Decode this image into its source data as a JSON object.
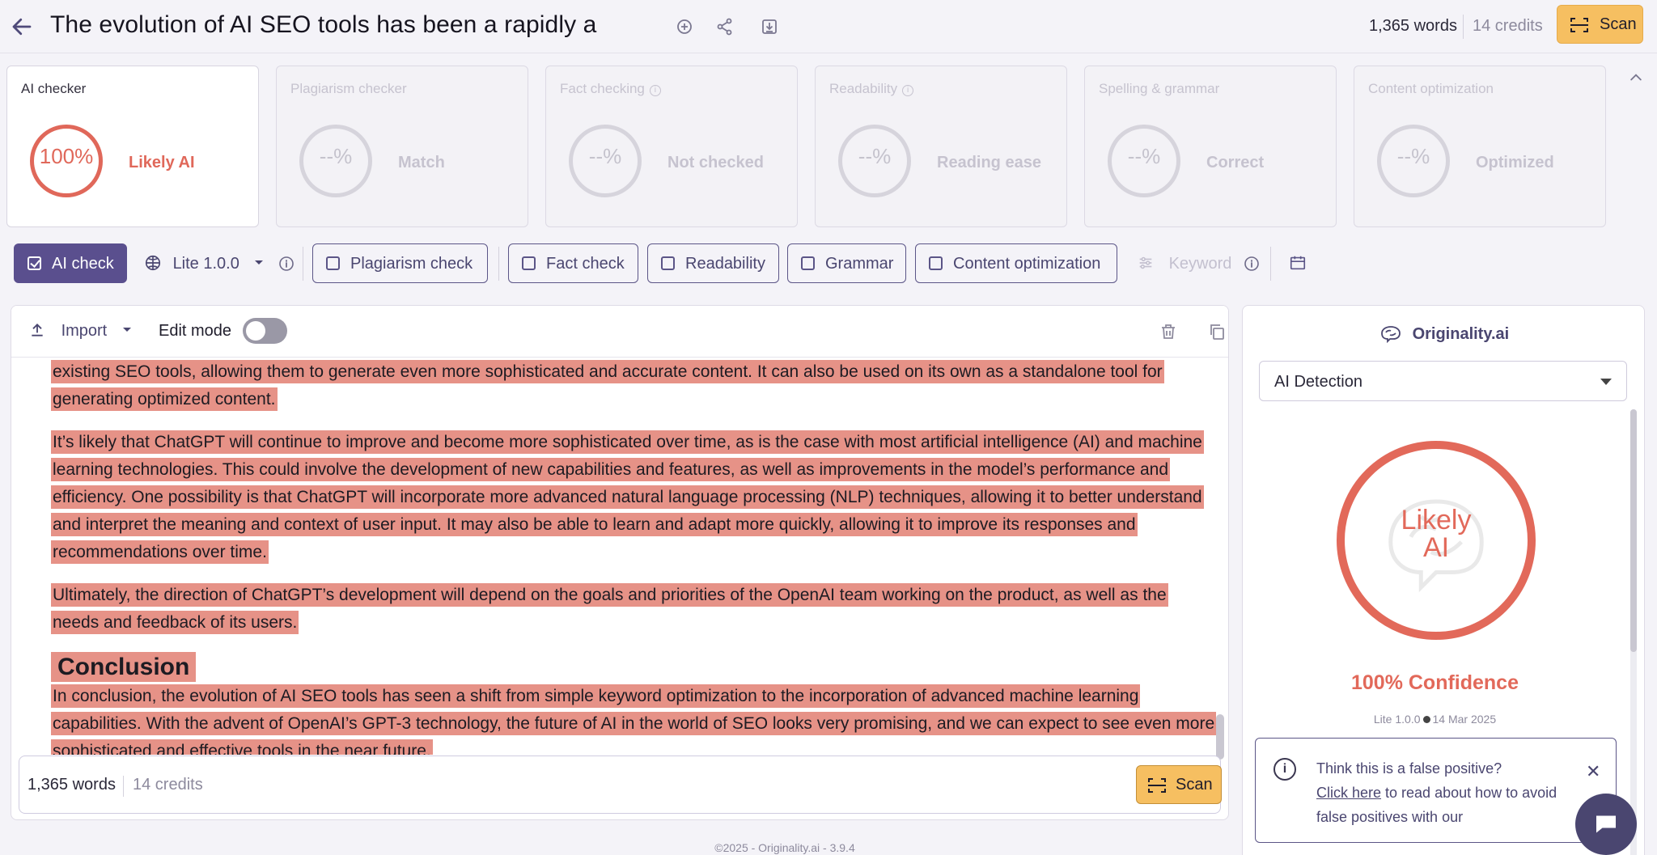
{
  "header": {
    "title": "The evolution of AI SEO tools has been a rapidly a",
    "words": "1,365 words",
    "credits": "14 credits",
    "scan_label": "Scan"
  },
  "cards": [
    {
      "title": "AI checker",
      "value": "100%",
      "status": "Likely AI",
      "active": true
    },
    {
      "title": "Plagiarism checker",
      "value": "--%",
      "status": "Match",
      "active": false
    },
    {
      "title": "Fact checking",
      "value": "--%",
      "status": "Not checked",
      "active": false
    },
    {
      "title": "Readability",
      "value": "--%",
      "status": "Reading ease",
      "active": false
    },
    {
      "title": "Spelling & grammar",
      "value": "--%",
      "status": "Correct",
      "active": false
    },
    {
      "title": "Content optimization",
      "value": "--%",
      "status": "Optimized",
      "active": false
    }
  ],
  "toolbar": {
    "ai_check": "AI check",
    "model": "Lite 1.0.0",
    "plagiarism": "Plagiarism check",
    "fact": "Fact check",
    "readability": "Readability",
    "grammar": "Grammar",
    "content_opt": "Content optimization",
    "keyword": "Keyword"
  },
  "editor": {
    "import_label": "Import",
    "edit_mode_label": "Edit mode",
    "paragraphs": [
      "existing SEO tools, allowing them to generate even more sophisticated and accurate content.   It can also be used on its own as a standalone tool for generating optimized content.",
      " It’s likely that ChatGPT will continue to improve and become more sophisticated over time, as is the case with most artificial intelligence (AI) and machine learning technologies.   This could involve the development of new capabilities and features, as well as improvements in the model’s performance and efficiency.   One possibility is that ChatGPT will incorporate more advanced natural language processing (NLP) techniques, allowing it to better understand and interpret the meaning and context of user input.   It may also be able to learn and adapt more quickly, allowing it to improve its responses and recommendations over time.",
      " Ultimately, the direction of ChatGPT’s development will depend on the goals and priorities of the OpenAI team working on the product, as well as the needs and feedback of its users."
    ],
    "heading": "Conclusion",
    "conclusion": " In conclusion, the evolution of AI SEO tools has seen a shift from simple keyword optimization to the incorporation of advanced machine learning capabilities.   With the advent of OpenAI’s GPT-3 technology, the future of AI in the world of SEO looks very promising, and we can expect to see even more sophisticated and effective tools in the near future.",
    "words": "1,365 words",
    "credits": "14 credits",
    "scan_label": "Scan"
  },
  "results": {
    "brand": "Originality.ai",
    "mode": "AI Detection",
    "ring_label_1": "Likely",
    "ring_label_2": "AI",
    "confidence": "100% Confidence",
    "model": "Lite 1.0.0",
    "date": "14 Mar 2025",
    "fp_title": "Think this is a false positive?",
    "fp_link": "Click here",
    "fp_rest": " to read about how to avoid false positives with our"
  },
  "footer": "©2025 - Originality.ai - 3.9.4",
  "colors": {
    "accent": "#5a4f8e",
    "ai_red": "#e2695a",
    "highlight": "#e69287",
    "scan": "#f6bf61"
  }
}
